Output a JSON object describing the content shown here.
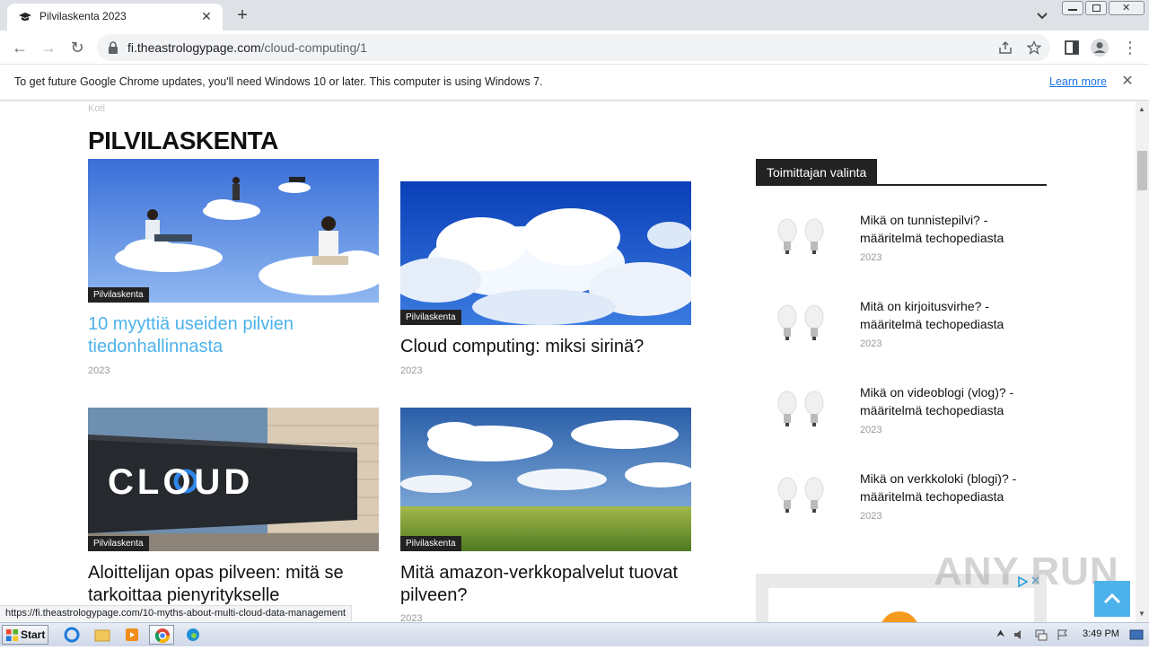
{
  "browser": {
    "tab_title": "Pilvilaskenta 2023",
    "url_domain": "fi.theastrologypage.com",
    "url_path": "/cloud-computing/1",
    "infobar_message": "To get future Google Chrome updates, you'll need Windows 10 or later. This computer is using Windows 7.",
    "infobar_link": "Learn more",
    "status_url": "https://fi.theastrologypage.com/10-myths-about-multi-cloud-data-management"
  },
  "page": {
    "breadcrumb": "Koti",
    "title": "PILVILASKENTA",
    "cards": [
      {
        "category": "Pilvilaskenta",
        "title": "10 myyttiä useiden pilvien tiedonhallinnasta",
        "year": "2023"
      },
      {
        "category": "Pilvilaskenta",
        "title": "Cloud computing: miksi sirinä?",
        "year": "2023"
      },
      {
        "category": "Pilvilaskenta",
        "title": "Aloittelijan opas pilveen: mitä se tarkoittaa pienyritykselle",
        "year": ""
      },
      {
        "category": "Pilvilaskenta",
        "title": "Mitä amazon-verkkopalvelut tuovat pilveen?",
        "year": "2023"
      }
    ],
    "card_images": [
      "CLOUD"
    ],
    "sidebar": {
      "heading": "Toimittajan valinta",
      "items": [
        {
          "title": "Mikä on tunnistepilvi? - määritelmä techopediasta",
          "year": "2023"
        },
        {
          "title": "Mitä on kirjoitusvirhe? - määritelmä techopediasta",
          "year": "2023"
        },
        {
          "title": "Mikä on videoblogi (vlog)? - määritelmä techopediasta",
          "year": "2023"
        },
        {
          "title": "Mikä on verkkoloki (blogi)? - määritelmä techopediasta",
          "year": "2023"
        }
      ]
    },
    "watermark": "ANY RUN"
  },
  "taskbar": {
    "start_label": "Start",
    "clock": "3:49 PM"
  },
  "colors": {
    "link_blue": "#4db2ec",
    "category_bg": "#222222",
    "tab_strip": "#dee1e6"
  }
}
